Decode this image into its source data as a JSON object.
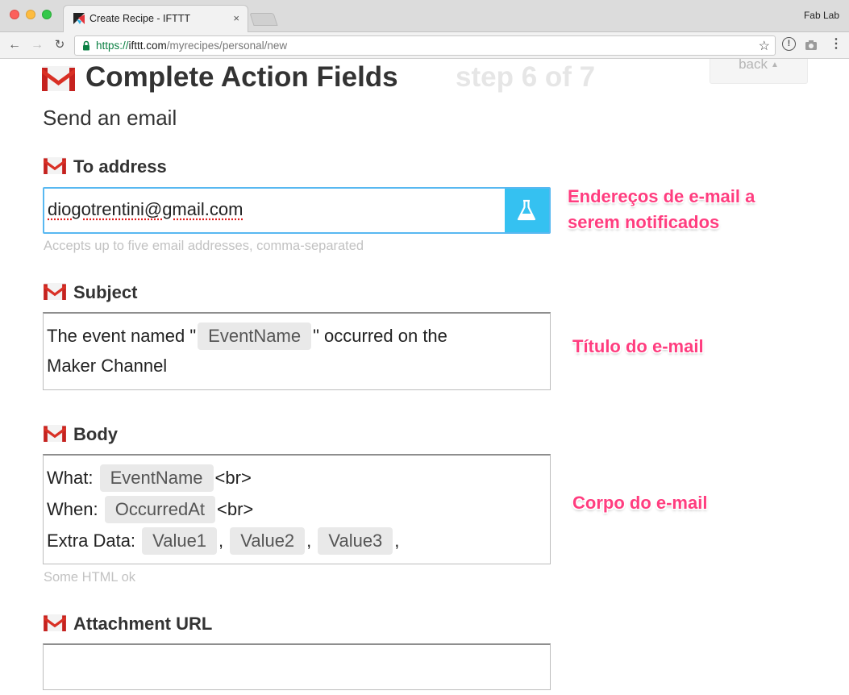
{
  "browser": {
    "tab_title": "Create Recipe - IFTTT",
    "tab_close": "×",
    "profile_name": "Fab Lab",
    "url": {
      "scheme": "https://",
      "host": "ifttt.com",
      "path": "/myrecipes/personal/new"
    }
  },
  "header": {
    "title": "Complete Action Fields",
    "step": "step 6 of 7",
    "back_label": "back",
    "back_caret": "▲",
    "subtitle": "Send an email"
  },
  "fields": {
    "to_address": {
      "label": "To address",
      "value": "diogotrentini@gmail.com",
      "helper": "Accepts up to five email addresses, comma-separated"
    },
    "subject": {
      "label": "Subject",
      "line1_before": "The event named \"",
      "line1_pill": "EventName",
      "line1_after": "\" occurred on the",
      "line2": "Maker Channel"
    },
    "body": {
      "label": "Body",
      "line1_label": "What:",
      "line1_pill": "EventName",
      "line1_after": "<br>",
      "line2_label": "When:",
      "line2_pill": "OccurredAt",
      "line2_after": "<br>",
      "line3_label": "Extra Data:",
      "line3_pills": [
        "Value1",
        "Value2",
        "Value3"
      ],
      "separator": ",",
      "helper": "Some HTML ok"
    },
    "attachment": {
      "label": "Attachment URL",
      "value": ""
    }
  },
  "annotations": {
    "to_address_line1": "Endereços de e-mail a",
    "to_address_line2": "serem notificados",
    "subject": "Título do e-mail",
    "body": "Corpo do e-mail"
  },
  "colors": {
    "accent": "#35c1f1",
    "annotation": "#ff3d7f",
    "gmail_red": "#c5221f",
    "focus_border": "#58b8f1"
  },
  "icons": [
    "gmail-icon",
    "flask-icon",
    "lock-icon",
    "star-icon",
    "ifttt-favicon"
  ]
}
